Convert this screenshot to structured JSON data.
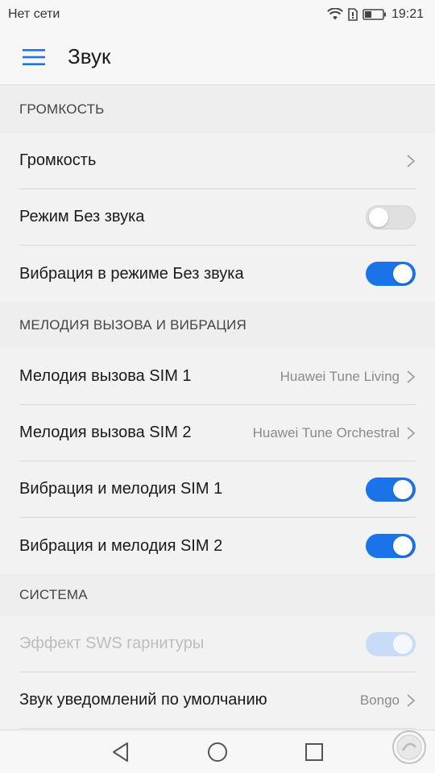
{
  "status_bar": {
    "network": "Нет сети",
    "time": "19:21",
    "icons": [
      "wifi-icon",
      "sim-icon",
      "battery-icon"
    ]
  },
  "app_bar": {
    "title": "Звук",
    "menu_icon": "hamburger-menu-icon"
  },
  "sections": {
    "volume": {
      "header": "ГРОМКОСТЬ",
      "items": [
        {
          "label": "Громкость"
        },
        {
          "label": "Режим Без звука",
          "toggle": false
        },
        {
          "label": "Вибрация в режиме Без звука",
          "toggle": true
        }
      ]
    },
    "ringtone": {
      "header": "МЕЛОДИЯ ВЫЗОВА И ВИБРАЦИЯ",
      "items": [
        {
          "label": "Мелодия вызова SIM 1",
          "value": "Huawei Tune Living"
        },
        {
          "label": "Мелодия вызова SIM 2",
          "value": "Huawei Tune Orchestral"
        },
        {
          "label": "Вибрация и мелодия SIM 1",
          "toggle": true
        },
        {
          "label": "Вибрация и мелодия SIM 2",
          "toggle": true
        }
      ]
    },
    "system": {
      "header": "СИСТЕМА",
      "items": [
        {
          "label": "Эффект SWS гарнитуры",
          "toggle": true,
          "disabled": true
        },
        {
          "label": "Звук уведомлений по умолчанию",
          "value": "Bongo"
        }
      ]
    }
  },
  "nav_bar": {
    "icons": [
      "back-icon",
      "home-icon",
      "recents-icon"
    ]
  },
  "colors": {
    "accent": "#1a73e8",
    "background": "#f2f2f2",
    "toggle_off": "#e0e0e0"
  }
}
